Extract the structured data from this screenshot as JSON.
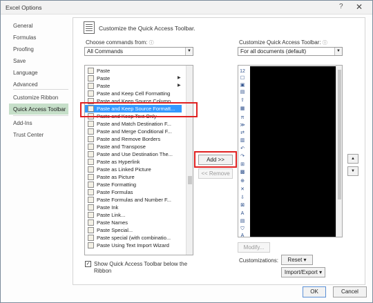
{
  "window": {
    "title": "Excel Options",
    "help_glyph": "?",
    "close_glyph": "✕"
  },
  "sidebar": {
    "items": [
      {
        "label": "General"
      },
      {
        "label": "Formulas"
      },
      {
        "label": "Proofing"
      },
      {
        "label": "Save"
      },
      {
        "label": "Language"
      },
      {
        "label": "Advanced"
      },
      {
        "label": "Customize Ribbon"
      },
      {
        "label": "Quick Access Toolbar",
        "active": true
      },
      {
        "label": "Add-Ins"
      },
      {
        "label": "Trust Center"
      }
    ]
  },
  "header": {
    "title": "Customize the Quick Access Toolbar.",
    "icon": "toolbar-icon"
  },
  "left_panel": {
    "choose_label": "Choose commands from:",
    "choose_value": "All Commands",
    "commands": [
      {
        "label": "Paste"
      },
      {
        "label": "Paste",
        "submenu": true
      },
      {
        "label": "Paste",
        "submenu": true
      },
      {
        "label": "Paste and Keep Cell Formatting"
      },
      {
        "label": "Paste and Keep Source Column..."
      },
      {
        "label": "Paste and Keep Source Formatt...",
        "selected": true
      },
      {
        "label": "Paste and Keep Text Only"
      },
      {
        "label": "Paste and Match Destination F..."
      },
      {
        "label": "Paste and Merge Conditional F..."
      },
      {
        "label": "Paste and Remove Borders"
      },
      {
        "label": "Paste and Transpose"
      },
      {
        "label": "Paste and Use Destination The..."
      },
      {
        "label": "Paste as Hyperlink"
      },
      {
        "label": "Paste as Linked Picture"
      },
      {
        "label": "Paste as Picture"
      },
      {
        "label": "Paste Formatting"
      },
      {
        "label": "Paste Formulas"
      },
      {
        "label": "Paste Formulas and Number F..."
      },
      {
        "label": "Paste Ink"
      },
      {
        "label": "Paste Link..."
      },
      {
        "label": "Paste Names"
      },
      {
        "label": "Paste Special..."
      },
      {
        "label": "Paste special (with combinatio..."
      },
      {
        "label": "Paste Using Text Import Wizard"
      }
    ],
    "show_below_label": "Show Quick Access Toolbar below the Ribbon",
    "show_below_checked": true,
    "show_below_glyph": "✓"
  },
  "middle": {
    "add_label": "Add >>",
    "remove_label": "<< Remove"
  },
  "right_panel": {
    "customize_label": "Customize Quick Access Toolbar:",
    "customize_value": "For all documents (default)",
    "qat_items": [
      "12",
      "☐",
      "▣",
      "▤",
      "⇧",
      "▦",
      "π",
      "≫",
      "⇄",
      "▥",
      "↶",
      "↷",
      "⊞",
      "▩",
      "⊕",
      "✕",
      "⇩",
      "⊠",
      "A",
      "▤",
      "⛉",
      "A"
    ],
    "modify_label": "Modify...",
    "customizations_label": "Customizations:",
    "reset_label": "Reset ▾",
    "import_export_label": "Import/Export ▾",
    "up_arrow": "▲",
    "down_arrow": "▼"
  },
  "footer": {
    "ok_label": "OK",
    "cancel_label": "Cancel"
  },
  "accent": {
    "selection": "#3399ff",
    "nav_active": "#c6dfc9",
    "highlight_box": "#e02020"
  }
}
